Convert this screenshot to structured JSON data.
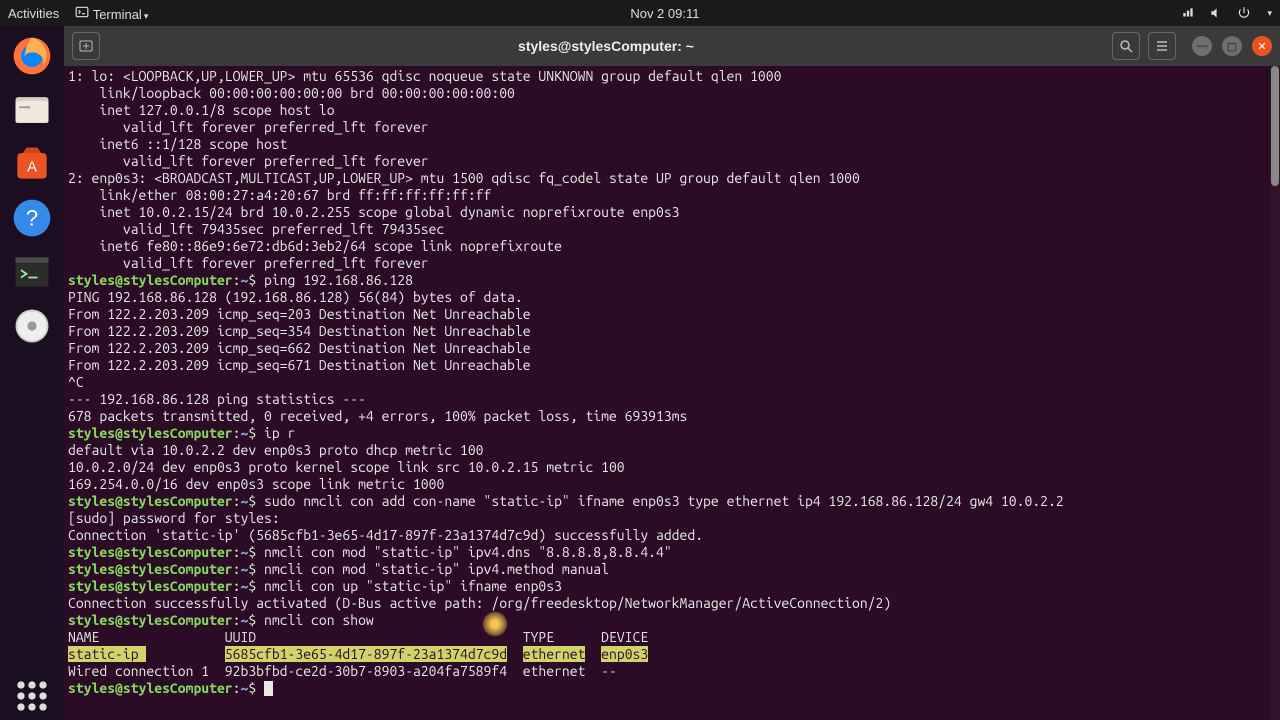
{
  "topbar": {
    "activities": "Activities",
    "terminal": "Terminal",
    "datetime": "Nov 2  09:11"
  },
  "window": {
    "title": "styles@stylesComputer: ~"
  },
  "prompt": {
    "user": "styles@stylesComputer",
    "path": "~",
    "sep": ":",
    "dollar": "$"
  },
  "lines": {
    "l1": "1: lo: <LOOPBACK,UP,LOWER_UP> mtu 65536 qdisc noqueue state UNKNOWN group default qlen 1000",
    "l2": "    link/loopback 00:00:00:00:00:00 brd 00:00:00:00:00:00",
    "l3": "    inet 127.0.0.1/8 scope host lo",
    "l4": "       valid_lft forever preferred_lft forever",
    "l5": "    inet6 ::1/128 scope host",
    "l6": "       valid_lft forever preferred_lft forever",
    "l7": "2: enp0s3: <BROADCAST,MULTICAST,UP,LOWER_UP> mtu 1500 qdisc fq_codel state UP group default qlen 1000",
    "l8": "    link/ether 08:00:27:a4:20:67 brd ff:ff:ff:ff:ff:ff",
    "l9": "    inet 10.0.2.15/24 brd 10.0.2.255 scope global dynamic noprefixroute enp0s3",
    "l10": "       valid_lft 79435sec preferred_lft 79435sec",
    "l11": "    inet6 fe80::86e9:6e72:db6d:3eb2/64 scope link noprefixroute",
    "l12": "       valid_lft forever preferred_lft forever",
    "c1": " ping 192.168.86.128",
    "l13": "PING 192.168.86.128 (192.168.86.128) 56(84) bytes of data.",
    "l14": "From 122.2.203.209 icmp_seq=203 Destination Net Unreachable",
    "l15": "From 122.2.203.209 icmp_seq=354 Destination Net Unreachable",
    "l16": "From 122.2.203.209 icmp_seq=662 Destination Net Unreachable",
    "l17": "From 122.2.203.209 icmp_seq=671 Destination Net Unreachable",
    "l18": "^C",
    "l19": "--- 192.168.86.128 ping statistics ---",
    "l20": "678 packets transmitted, 0 received, +4 errors, 100% packet loss, time 693913ms",
    "l21": "",
    "c2": " ip r",
    "l22": "default via 10.0.2.2 dev enp0s3 proto dhcp metric 100",
    "l23": "10.0.2.0/24 dev enp0s3 proto kernel scope link src 10.0.2.15 metric 100",
    "l24": "169.254.0.0/16 dev enp0s3 scope link metric 1000",
    "c3": " sudo nmcli con add con-name \"static-ip\" ifname enp0s3 type ethernet ip4 192.168.86.128/24 gw4 10.0.2.2",
    "l25": "[sudo] password for styles:",
    "l26": "Connection 'static-ip' (5685cfb1-3e65-4d17-897f-23a1374d7c9d) successfully added.",
    "c4": " nmcli con mod \"static-ip\" ipv4.dns \"8.8.8.8,8.8.4.4\"",
    "c5": " nmcli con mod \"static-ip\" ipv4.method manual",
    "c6": " nmcli con up \"static-ip\" ifname enp0s3",
    "l27": "Connection successfully activated (D-Bus active path: /org/freedesktop/NetworkManager/ActiveConnection/2)",
    "c7": " nmcli con show",
    "th": "NAME                UUID                                  TYPE      DEVICE",
    "tr1a": "static-ip ",
    "tr1b": "          ",
    "tr1c": "5685cfb1-3e65-4d17-897f-23a1374d7c9d",
    "tr1d": "  ",
    "tr1e": "ethernet",
    "tr1f": "  ",
    "tr1g": "enp0s3",
    "tr2": "Wired connection 1  92b3bfbd-ce2d-30b7-8903-a204fa7589f4  ethernet  --",
    "c8": " "
  }
}
